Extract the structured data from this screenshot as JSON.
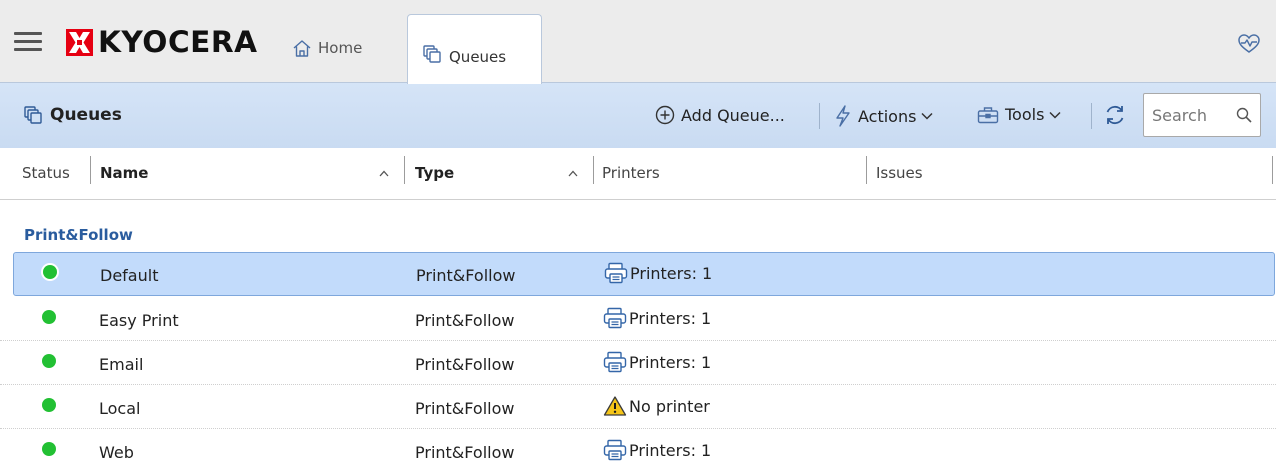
{
  "app": {
    "logo_text": "KYOCERA",
    "brand_color": "#e60012",
    "accent_color": "#2a5c9e",
    "status_ok_color": "#22c033"
  },
  "tabs": [
    {
      "label": "Home",
      "icon": "home-icon",
      "active": false
    },
    {
      "label": "Queues",
      "icon": "queues-icon",
      "active": true
    }
  ],
  "header_icons": {
    "health": "heart-pulse-icon"
  },
  "toolbar": {
    "title": "Queues",
    "add_label": "Add Queue...",
    "actions_label": "Actions",
    "tools_label": "Tools",
    "search_placeholder": "Search"
  },
  "columns": {
    "status": "Status",
    "name": "Name",
    "type": "Type",
    "printers": "Printers",
    "issues": "Issues"
  },
  "group": {
    "label": "Print&Follow"
  },
  "rows": [
    {
      "name": "Default",
      "type": "Print&Follow",
      "printers": "Printers: 1",
      "printer_icon": "printer-icon",
      "status": "ok",
      "selected": true
    },
    {
      "name": "Easy Print",
      "type": "Print&Follow",
      "printers": "Printers: 1",
      "printer_icon": "printer-icon",
      "status": "ok",
      "selected": false
    },
    {
      "name": "Email",
      "type": "Print&Follow",
      "printers": "Printers: 1",
      "printer_icon": "printer-icon",
      "status": "ok",
      "selected": false
    },
    {
      "name": "Local",
      "type": "Print&Follow",
      "printers": "No printer",
      "printer_icon": "warning-icon",
      "status": "ok",
      "selected": false
    },
    {
      "name": "Web",
      "type": "Print&Follow",
      "printers": "Printers: 1",
      "printer_icon": "printer-icon",
      "status": "ok",
      "selected": false
    }
  ]
}
